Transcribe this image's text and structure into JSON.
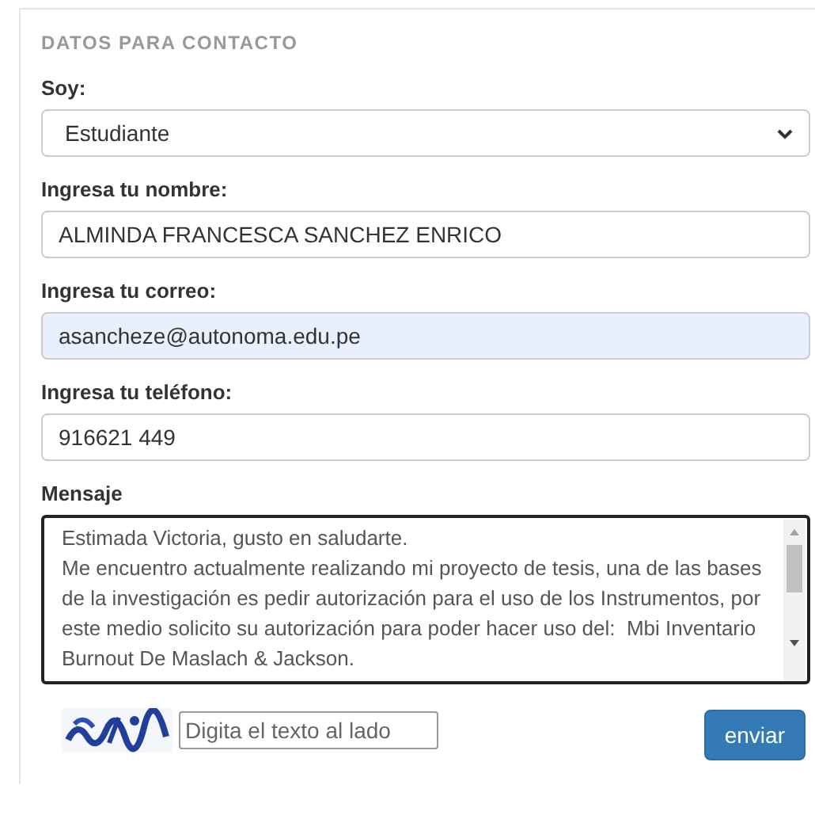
{
  "section_title": "DATOS PARA CONTACTO",
  "fields": [
    {
      "kind": "select",
      "label": "Soy:",
      "value": "Estudiante",
      "focused": false
    },
    {
      "kind": "text",
      "label": "Ingresa tu nombre:",
      "value": "ALMINDA FRANCESCA SANCHEZ ENRICO",
      "focused": false,
      "autofilled": false
    },
    {
      "kind": "text",
      "label": "Ingresa tu correo:",
      "value": "asancheze@autonoma.edu.pe",
      "focused": false,
      "autofilled": true
    },
    {
      "kind": "text",
      "label": "Ingresa tu teléfono:",
      "value": "916621 449",
      "focused": false,
      "autofilled": false
    },
    {
      "kind": "textarea",
      "label": "Mensaje",
      "value": "Estimada Victoria, gusto en saludarte.\nMe encuentro actualmente realizando mi proyecto de tesis, una de las bases de la investigación es pedir autorización para el uso de los Instrumentos, por este medio solicito su autorización para poder hacer uso del:  Mbi Inventario Burnout De Maslach & Jackson.",
      "focused": true
    }
  ],
  "captcha": {
    "placeholder": "Digita el texto al lado"
  },
  "submit": "enviar"
}
